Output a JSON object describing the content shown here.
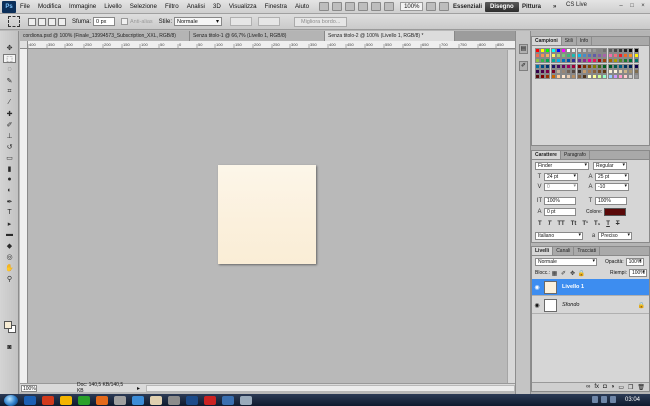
{
  "menubar": {
    "logo": "Ps",
    "items": [
      "File",
      "Modifica",
      "Immagine",
      "Livello",
      "Selezione",
      "Filtro",
      "Analisi",
      "3D",
      "Visualizza",
      "Finestra",
      "Aiuto"
    ],
    "zoom": "100%",
    "workspaces": [
      "Essenziali",
      "Disegno",
      "Pittura"
    ],
    "workspace_active": "Disegno",
    "more": "»",
    "cs_live": "CS Live",
    "window_controls": [
      "–",
      "□",
      "×"
    ]
  },
  "options_bar": {
    "feather_label": "Sfuma:",
    "feather_value": "0 px",
    "antialias_label": "Anti-alias",
    "style_label": "Stile:",
    "style_value": "Normale",
    "refine_label": "Migliora bordo..."
  },
  "documents": {
    "tabs": [
      "cordiona.psd @ 100% (Finale_13994573_Subscription_XXL, RGB/8)",
      "Senza titolo-1 @ 66,7% (Livello 1, RGB/8)",
      "Senza titolo-2 @ 100% (Livello 1, RGB/8) *"
    ],
    "active": 2,
    "ruler_marks": [
      "400",
      "350",
      "300",
      "250",
      "200",
      "150",
      "100",
      "50",
      "0",
      "50",
      "100",
      "150",
      "200",
      "250",
      "300",
      "350",
      "400",
      "450",
      "500",
      "550",
      "600",
      "650",
      "700",
      "750",
      "800",
      "850"
    ]
  },
  "statusbar": {
    "zoom": "100%",
    "doc_info": "Doc: 140,5 KB/140,5 KB",
    "arrow": "▸"
  },
  "panels": {
    "swatches_tabs": [
      "Campioni",
      "Stili",
      "Info"
    ],
    "char_tabs": [
      "Carattere",
      "Paragrafo"
    ],
    "font_family": "Finder",
    "font_style": "Regular",
    "font_size": "24 pt",
    "leading": "25 pt",
    "kerning": "0",
    "tracking": "-10",
    "vscale": "100%",
    "hscale": "100%",
    "baseline": "0 pt",
    "color_label": "Colore:",
    "language": "Italiano",
    "antialias": "Preciso",
    "layers_tabs": [
      "Livelli",
      "Canali",
      "Tracciati"
    ],
    "blend_mode": "Normale",
    "opacity_label": "Opacità:",
    "opacity": "100%",
    "lock_label": "Blocc.:",
    "fill_label": "Riempi:",
    "fill": "100%",
    "layers": [
      {
        "name": "Livello 1",
        "selected": true
      },
      {
        "name": "Sfondo",
        "selected": false
      }
    ]
  },
  "taskbar": {
    "time": "03:04",
    "icon_colors": [
      "#1a5fb4",
      "#d23a1c",
      "#f3b400",
      "#2aa12a",
      "#e46a1a",
      "#a0a0a0",
      "#3c8dd8",
      "#e0d0b0",
      "#8c8c8c",
      "#1c4b8a",
      "#cc2222",
      "#3a6fb0",
      "#9ab"
    ]
  },
  "colors": {
    "selection": "#3d8df0",
    "foreground": "#f7ecd4",
    "text_color": "#5b0a0a"
  }
}
